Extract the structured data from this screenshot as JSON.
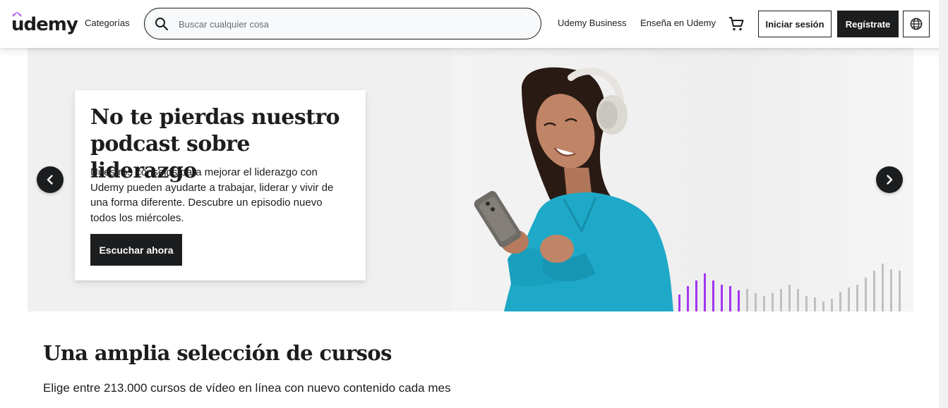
{
  "header": {
    "logo_text": "udemy",
    "categories_label": "Categorías",
    "search": {
      "placeholder": "Buscar cualquier cosa",
      "value": ""
    },
    "business_label": "Udemy Business",
    "teach_label": "Enseña en Udemy",
    "login_label": "Iniciar sesión",
    "signup_label": "Regístrate",
    "icons": {
      "search": "search-icon",
      "cart": "cart-icon",
      "language": "globe-icon"
    }
  },
  "hero": {
    "title": "No te pierdas nuestro podcast sobre liderazgo",
    "description": "Nuestros consejos para mejorar el liderazgo con Udemy pueden ayudarte a trabajar, liderar y vivir de una forma diferente. Descubre un episodio nuevo todos los miércoles.",
    "cta_label": "Escuchar ahora",
    "prev_icon": "chevron-left-icon",
    "next_icon": "chevron-right-icon"
  },
  "courses_section": {
    "title": "Una amplia selección de cursos",
    "subtitle": "Elige entre 213.000 cursos de vídeo en línea con nuevo contenido cada mes"
  },
  "colors": {
    "brand_purple": "#a435f0",
    "dark": "#1c1d1f",
    "shirt": "#1ea9c8",
    "bar_grey": "#c0c0c0"
  }
}
